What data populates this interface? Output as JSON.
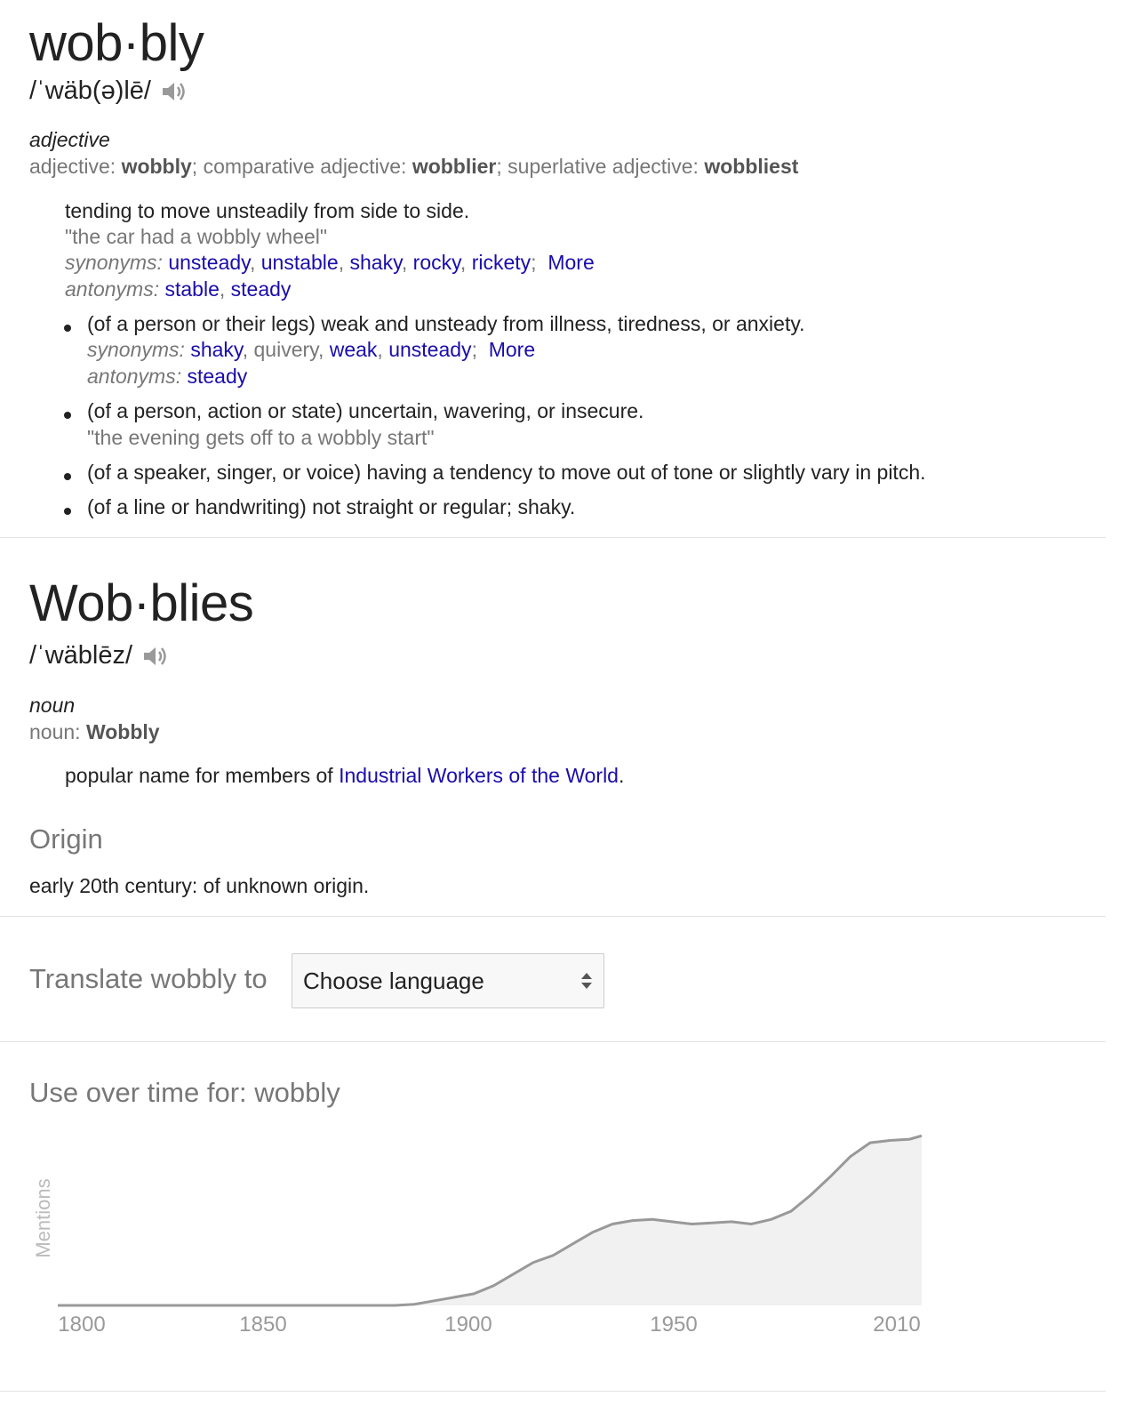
{
  "entry1": {
    "word": "wob·bly",
    "pron": "/ˈwäb(ə)lē/",
    "pos": "adjective",
    "forms": {
      "p1": "adjective: ",
      "b1": "wobbly",
      "p2": "; comparative adjective: ",
      "b2": "wobblier",
      "p3": "; superlative adjective: ",
      "b3": "wobbliest"
    },
    "sense1": {
      "def": "tending to move unsteadily from side to side.",
      "example": "\"the car had a wobbly wheel\"",
      "syn_label": "synonyms:",
      "synonyms": [
        "unsteady",
        "unstable",
        "shaky",
        "rocky",
        "rickety"
      ],
      "more": "More",
      "ant_label": "antonyms:",
      "antonyms": [
        "stable",
        "steady"
      ]
    },
    "sub1": {
      "def": "(of a person or their legs) weak and unsteady from illness, tiredness, or anxiety.",
      "syn_label": "synonyms:",
      "syn1": "shaky",
      "syn2": "quivery",
      "syn3": "weak",
      "syn4": "unsteady",
      "more": "More",
      "ant_label": "antonyms:",
      "ant1": "steady"
    },
    "sub2": {
      "def": "(of a person, action or state) uncertain, wavering, or insecure.",
      "example": "\"the evening gets off to a wobbly start\""
    },
    "sub3": {
      "def": "(of a speaker, singer, or voice) having a tendency to move out of tone or slightly vary in pitch."
    },
    "sub4": {
      "def": "(of a line or handwriting) not straight or regular; shaky."
    }
  },
  "entry2": {
    "word": "Wob·blies",
    "pron": "/ˈwäblēz/",
    "pos": "noun",
    "forms_p": "noun: ",
    "forms_b": "Wobbly",
    "def_pre": "popular name for members of ",
    "def_link": "Industrial Workers of the World",
    "def_post": "."
  },
  "origin": {
    "title": "Origin",
    "text": "early 20th century: of unknown origin."
  },
  "translate": {
    "label": "Translate wobbly to",
    "select_value": "Choose language"
  },
  "usage": {
    "title": "Use over time for: wobbly"
  },
  "chart_data": {
    "type": "area",
    "title": "Use over time for: wobbly",
    "ylabel": "Mentions",
    "xlabel": "",
    "x_ticks": [
      "1800",
      "1850",
      "1900",
      "1950",
      "2010"
    ],
    "x": [
      1795,
      1880,
      1885,
      1890,
      1895,
      1900,
      1905,
      1910,
      1915,
      1920,
      1925,
      1930,
      1935,
      1940,
      1945,
      1950,
      1955,
      1960,
      1965,
      1970,
      1975,
      1980,
      1985,
      1990,
      1995,
      2000,
      2005,
      2010,
      2013
    ],
    "values": [
      0,
      0,
      1,
      4,
      7,
      10,
      17,
      27,
      37,
      43,
      53,
      63,
      70,
      73,
      74,
      72,
      70,
      71,
      72,
      70,
      74,
      81,
      95,
      111,
      128,
      140,
      142,
      143,
      146
    ],
    "ylim": [
      0,
      150
    ],
    "grid": false,
    "line_color": "#999999",
    "fill_color": "#f1f1f1"
  }
}
